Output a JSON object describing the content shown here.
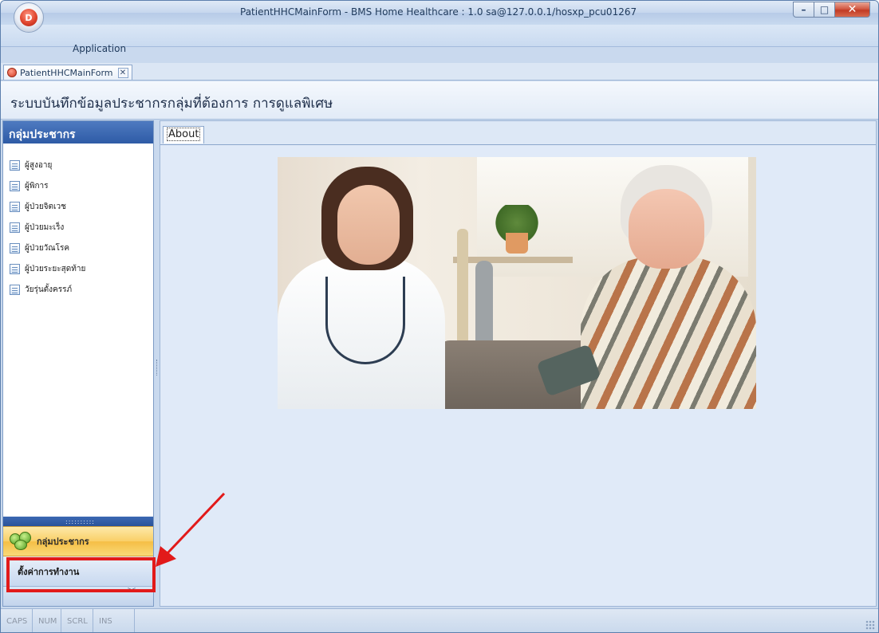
{
  "window": {
    "title": "PatientHHCMainForm - BMS Home Healthcare : 1.0 sa@127.0.0.1/hosxp_pcu01267",
    "controls": {
      "minimize": "–",
      "maximize": "□",
      "close": "✕"
    },
    "orb_letter": "D"
  },
  "ribbon": {
    "application_tab": "Application"
  },
  "document_tab": {
    "label": "PatientHHCMainForm",
    "close": "✕"
  },
  "header": {
    "title": "ระบบบันทึกข้อมูลประชากรกลุ่มที่ต้องการ การดูแลพิเศษ"
  },
  "nav": {
    "header": "กลุ่มประชากร",
    "items": [
      {
        "label": "ผู้สูงอายุ"
      },
      {
        "label": "ผู้พิการ"
      },
      {
        "label": "ผู้ป่วยจิตเวช"
      },
      {
        "label": "ผู้ป่วยมะเร็ง"
      },
      {
        "label": "ผู้ป่วยวัณโรค"
      },
      {
        "label": "ผู้ป่วยระยะสุดท้าย"
      },
      {
        "label": "วัยรุ่นตั้งครรภ์"
      }
    ],
    "group_button": "กลุ่มประชากร",
    "settings_button": "ตั้งค่าการทำงาน"
  },
  "content": {
    "tab": "About"
  },
  "status": {
    "caps": "CAPS",
    "num": "NUM",
    "scrl": "SCRL",
    "ins": "INS"
  },
  "colors": {
    "accent": "#2e5ba6",
    "group_button": "#f9cf67",
    "highlight": "#e21a1a"
  }
}
